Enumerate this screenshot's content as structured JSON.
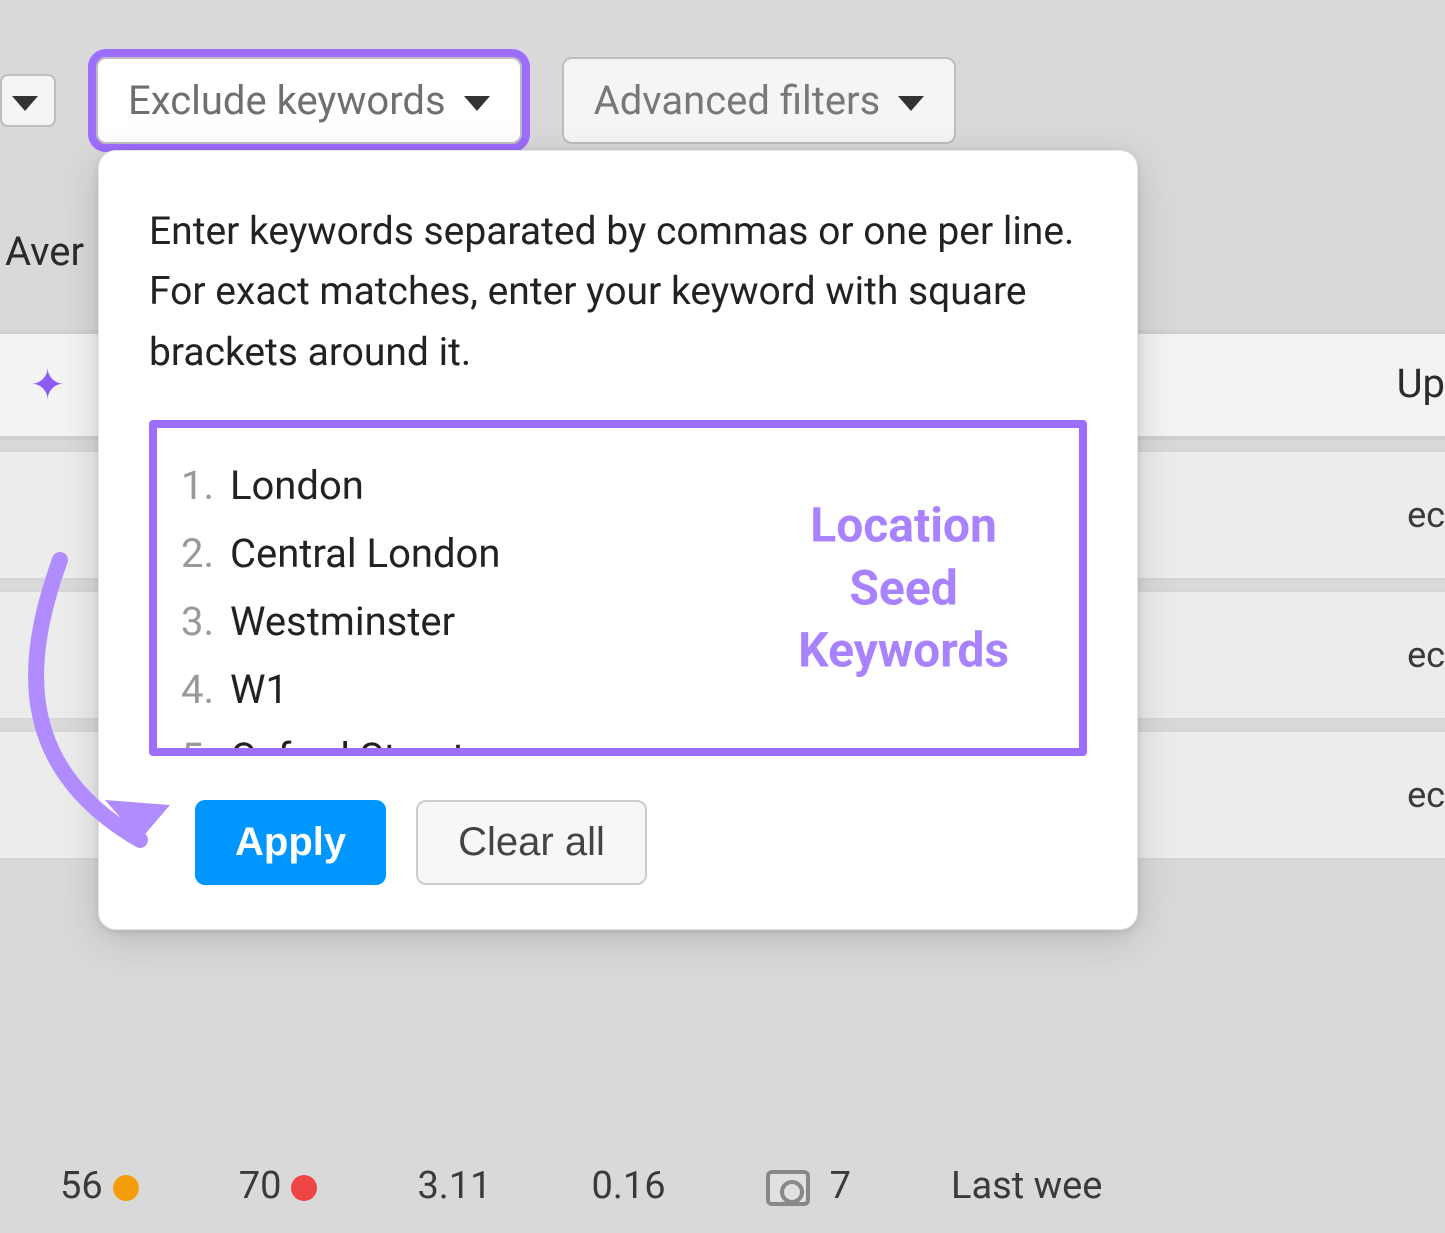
{
  "toolbar": {
    "exclude_label": "Exclude keywords",
    "advanced_label": "Advanced filters"
  },
  "background": {
    "avg_text": "Aver",
    "up_text": "Up",
    "ec_text": "ec",
    "metrics": {
      "val1": "56",
      "val2": "70",
      "val3": "3.11",
      "val4": "0.16",
      "val5": "7",
      "last": "Last wee"
    }
  },
  "popover": {
    "instruction": "Enter keywords separated by commas or one per line. For exact matches, enter your keyword with square brackets around it.",
    "keywords": [
      "London",
      "Central London",
      "Westminster",
      "W1",
      "Oxford Street"
    ],
    "overlay_line1": "Location",
    "overlay_line2": "Seed",
    "overlay_line3": "Keywords",
    "apply": "Apply",
    "clear": "Clear all"
  },
  "colors": {
    "highlight": "#9d6dff",
    "primary": "#0096ff"
  }
}
